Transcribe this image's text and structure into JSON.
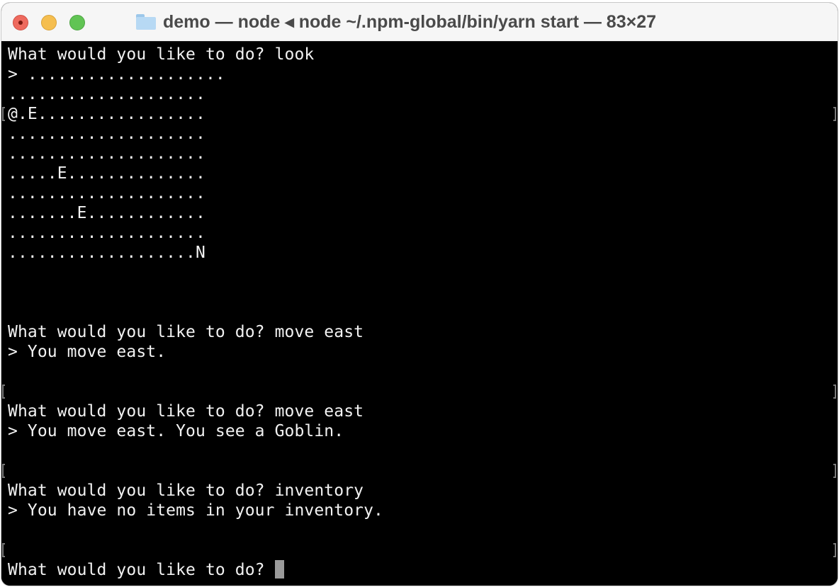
{
  "window": {
    "title": "demo — node ◂ node ~/.npm-global/bin/yarn start — 83×27",
    "folder_icon": "folder-icon",
    "controls": [
      "close",
      "minimize",
      "zoom"
    ]
  },
  "terminal": {
    "columns": 83,
    "rows": 27,
    "lines": [
      "What would you like to do? look",
      "> ....................",
      "....................",
      "@.E.................",
      "....................",
      "....................",
      ".....E..............",
      "....................",
      ".......E............",
      "....................",
      "...................N",
      "",
      "",
      "",
      "What would you like to do? move east",
      "> You move east.",
      "",
      "",
      "What would you like to do? move east",
      "> You move east. You see a Goblin.",
      "",
      "",
      "What would you like to do? inventory",
      "> You have no items in your inventory.",
      "",
      "",
      "What would you like to do? "
    ],
    "marked_rows": [
      3,
      17,
      21,
      25
    ],
    "cursor_row": 26
  }
}
